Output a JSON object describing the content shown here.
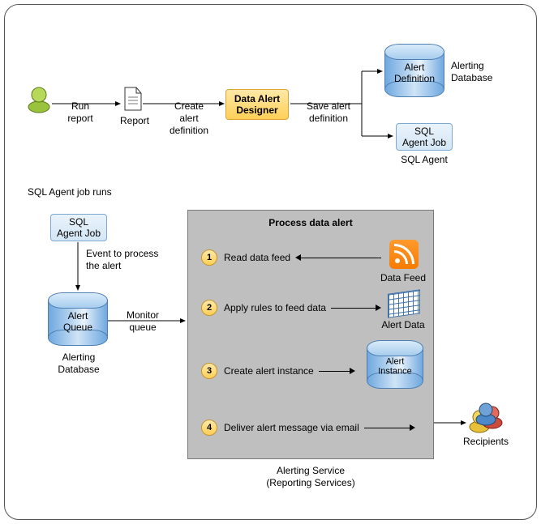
{
  "top": {
    "run_report": "Run\nreport",
    "report": "Report",
    "create_def": "Create\nalert\ndefinition",
    "designer": "Data Alert\nDesigner",
    "save_def": "Save alert\ndefinition",
    "alert_def": "Alert\nDefinition",
    "alerting_db": "Alerting\nDatabase",
    "sql_job": "SQL\nAgent Job",
    "sql_agent": "SQL Agent"
  },
  "mid": {
    "job_runs": "SQL Agent job runs",
    "sql_job": "SQL\nAgent Job",
    "event": "Event to process\nthe alert",
    "alert_queue": "Alert\nQueue",
    "alerting_db": "Alerting\nDatabase",
    "monitor": "Monitor\nqueue"
  },
  "proc": {
    "title": "Process data alert",
    "steps": [
      "Read data feed",
      "Apply rules to feed data",
      "Create alert instance",
      "Deliver alert message via email"
    ],
    "data_feed": "Data Feed",
    "alert_data": "Alert Data",
    "alert_instance": "Alert\nInstance",
    "caption": "Alerting Service\n(Reporting Services)"
  },
  "recipients": "Recipients"
}
